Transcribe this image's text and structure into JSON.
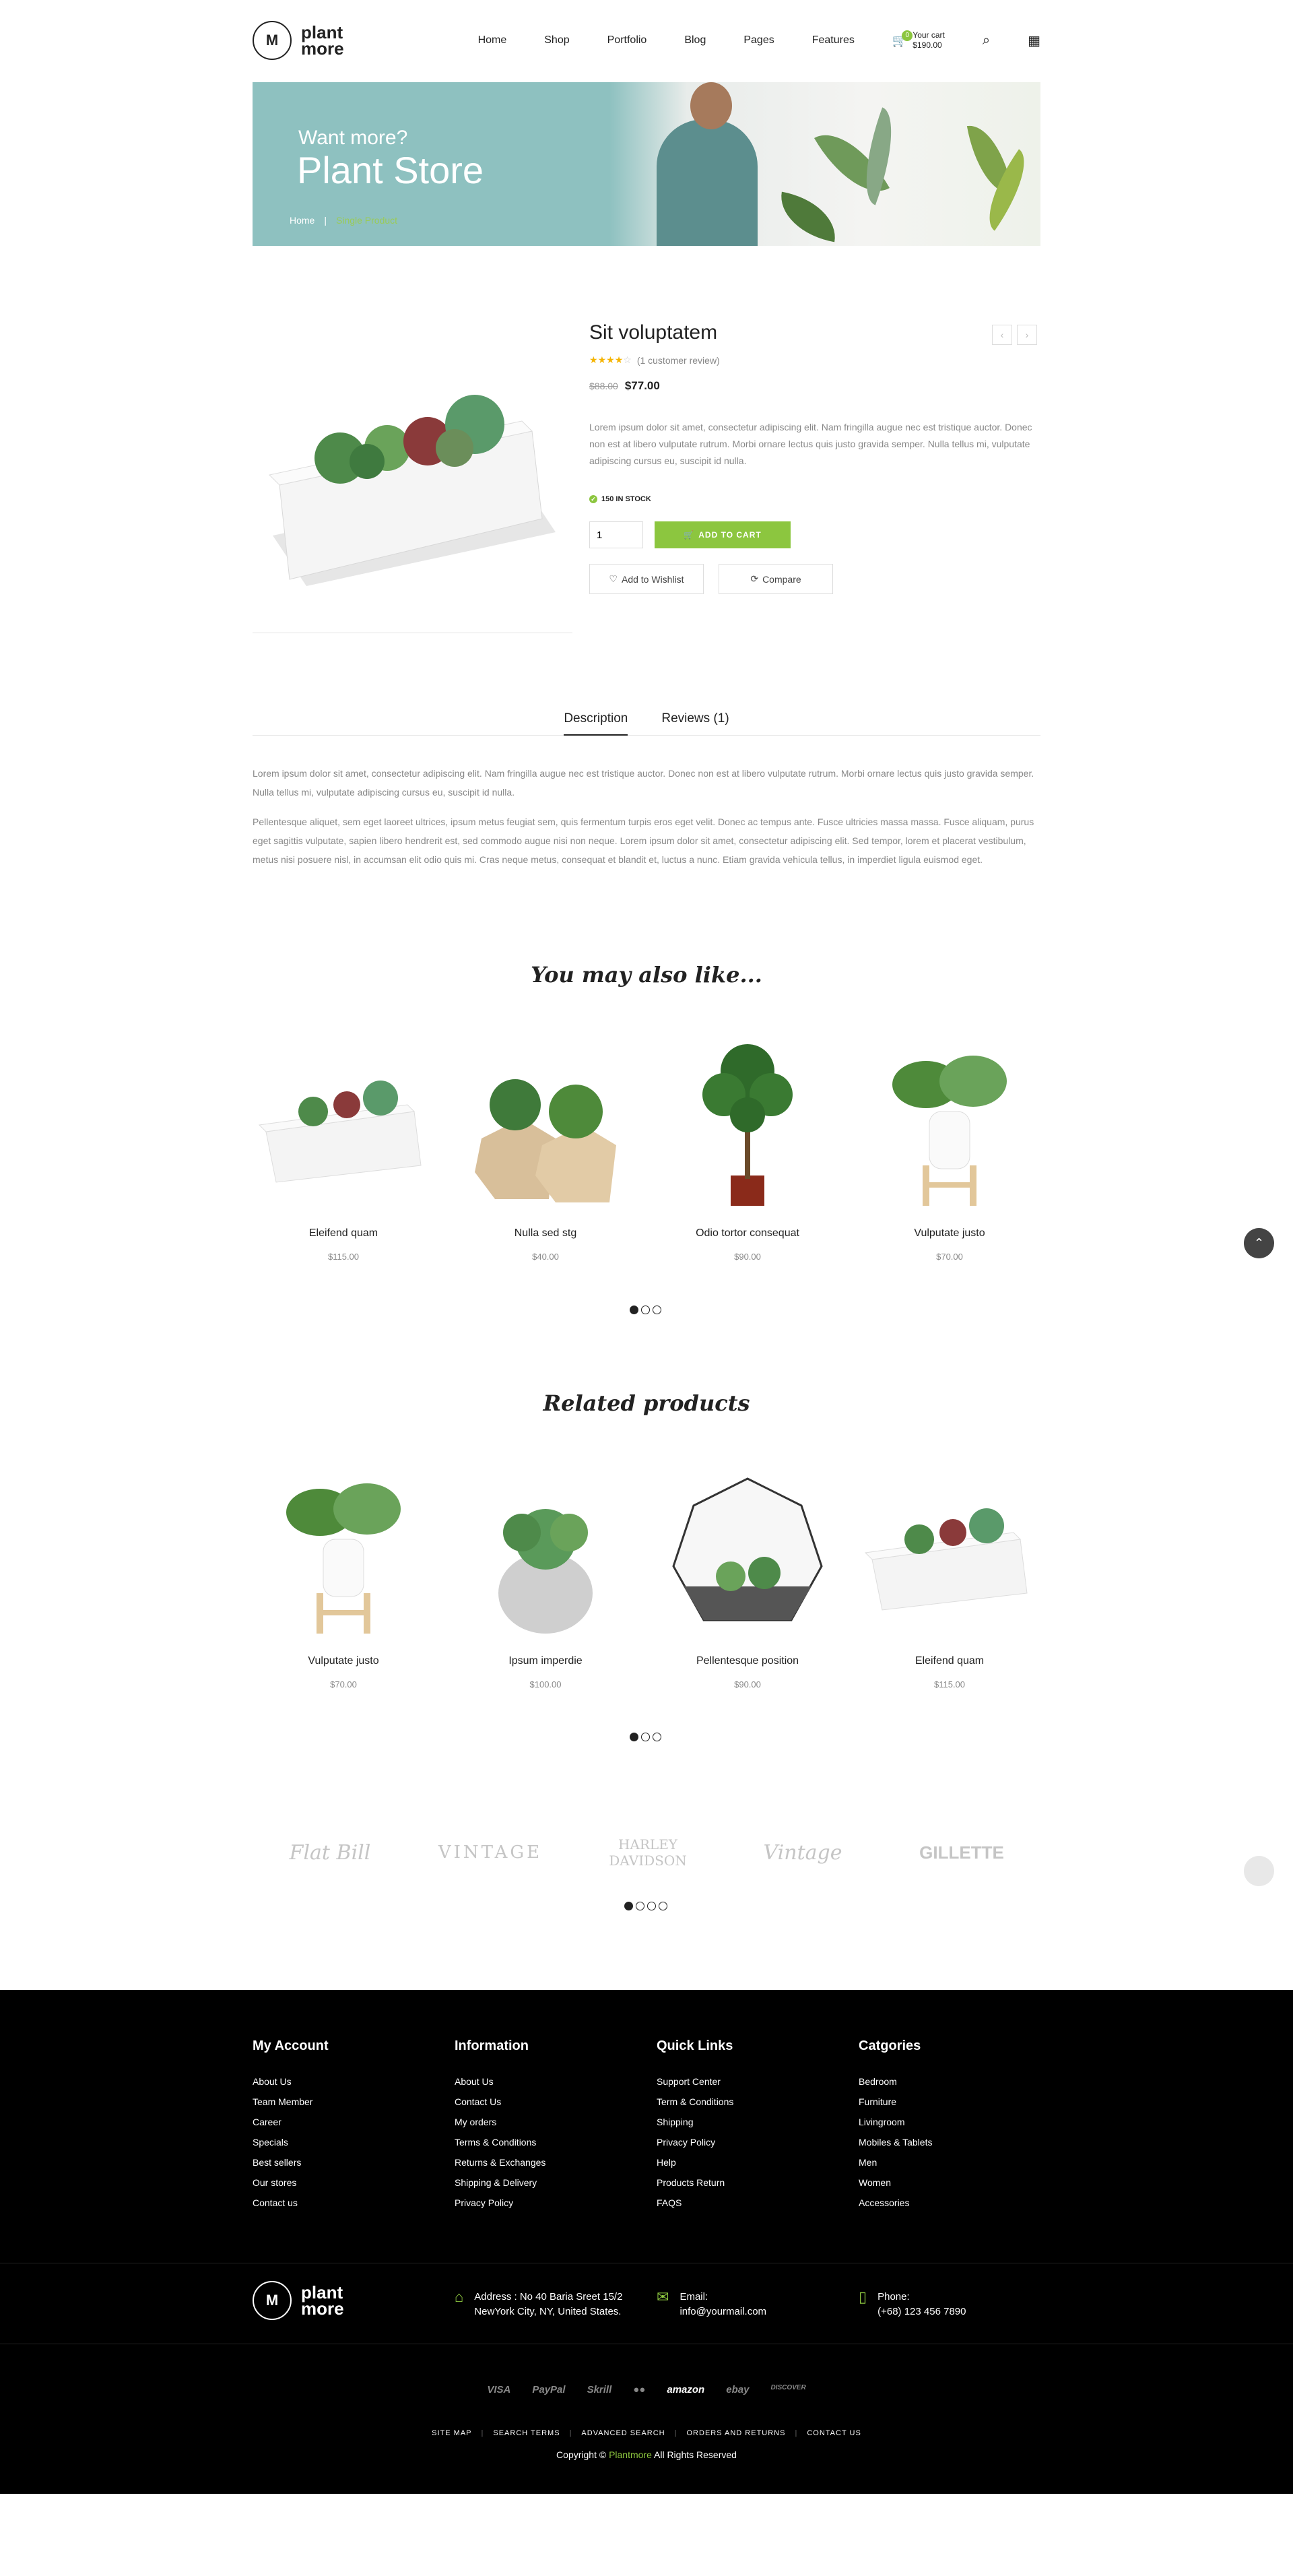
{
  "header": {
    "logo_mark": "M",
    "logo_line1": "plant",
    "logo_line2": "more",
    "nav": [
      "Home",
      "Shop",
      "Portfolio",
      "Blog",
      "Pages",
      "Features"
    ],
    "cart_count": "0",
    "cart_label": "Your cart",
    "cart_total": "$190.00"
  },
  "banner": {
    "subtitle": "Want more?",
    "title": "Plant Store",
    "crumb_home": "Home",
    "crumb_sep": "|",
    "crumb_current": "Single Product"
  },
  "product": {
    "title": "Sit voluptatem",
    "rating_stars": 4,
    "review_text": "(1 customer review)",
    "old_price": "$88.00",
    "new_price": "$77.00",
    "description": "Lorem ipsum dolor sit amet, consectetur adipiscing elit. Nam fringilla augue nec est tristique auctor. Donec non est at libero vulputate rutrum. Morbi ornare lectus quis justo gravida semper. Nulla tellus mi, vulputate adipiscing cursus eu, suscipit id nulla.",
    "stock": "150 IN STOCK",
    "qty": "1",
    "add_to_cart": "ADD TO CART",
    "wishlist": "Add to Wishlist",
    "compare": "Compare",
    "prev": "‹",
    "next": "›"
  },
  "tabs": {
    "description": "Description",
    "reviews": "Reviews (1)",
    "p1": "Lorem ipsum dolor sit amet, consectetur adipiscing elit. Nam fringilla augue nec est tristique auctor. Donec non est at libero vulputate rutrum. Morbi ornare lectus quis justo gravida semper. Nulla tellus mi, vulputate adipiscing cursus eu, suscipit id nulla.",
    "p2": "Pellentesque aliquet, sem eget laoreet ultrices, ipsum metus feugiat sem, quis fermentum turpis eros eget velit. Donec ac tempus ante. Fusce ultricies massa massa. Fusce aliquam, purus eget sagittis vulputate, sapien libero hendrerit est, sed commodo augue nisi non neque. Lorem ipsum dolor sit amet, consectetur adipiscing elit. Sed tempor, lorem et placerat vestibulum, metus nisi posuere nisl, in accumsan elit odio quis mi. Cras neque metus, consequat et blandit et, luctus a nunc. Etiam gravida vehicula tellus, in imperdiet ligula euismod eget."
  },
  "also_like": {
    "title": "You may also like...",
    "items": [
      {
        "name": "Eleifend quam",
        "price": "$115.00"
      },
      {
        "name": "Nulla sed stg",
        "price": "$40.00"
      },
      {
        "name": "Odio tortor consequat",
        "price": "$90.00"
      },
      {
        "name": "Vulputate justo",
        "price": "$70.00"
      }
    ]
  },
  "related": {
    "title": "Related products",
    "items": [
      {
        "name": "Vulputate justo",
        "price": "$70.00"
      },
      {
        "name": "Ipsum imperdie",
        "price": "$100.00"
      },
      {
        "name": "Pellentesque position",
        "price": "$90.00"
      },
      {
        "name": "Eleifend quam",
        "price": "$115.00"
      }
    ]
  },
  "brands": [
    "Flat Bill",
    "VINTAGE",
    "HARLEY DAVIDSON",
    "Vintage",
    "GILLETTE"
  ],
  "footer": {
    "cols": [
      {
        "title": "My Account",
        "items": [
          "About Us",
          "Team Member",
          "Career",
          "Specials",
          "Best sellers",
          "Our stores",
          "Contact us"
        ]
      },
      {
        "title": "Information",
        "items": [
          "About Us",
          "Contact Us",
          "My orders",
          "Terms & Conditions",
          "Returns & Exchanges",
          "Shipping & Delivery",
          "Privacy Policy"
        ]
      },
      {
        "title": "Quick Links",
        "items": [
          "Support Center",
          "Term & Conditions",
          "Shipping",
          "Privacy Policy",
          "Help",
          "Products Return",
          "FAQS"
        ]
      },
      {
        "title": "Catgories",
        "items": [
          "Bedroom",
          "Furniture",
          "Livingroom",
          "Mobiles & Tablets",
          "Men",
          "Women",
          "Accessories"
        ]
      }
    ],
    "address_line1": "Address : No 40 Baria Sreet 15/2",
    "address_line2": "NewYork City, NY, United States.",
    "email_label": "Email:",
    "email": "info@yourmail.com",
    "phone_label": "Phone:",
    "phone": "(+68) 123 456 7890",
    "payments": [
      "VISA",
      "PayPal",
      "Skrill",
      "●●",
      "amazon",
      "ebay",
      "DISCOVER"
    ],
    "links": [
      "SITE MAP",
      "SEARCH TERMS",
      "ADVANCED SEARCH",
      "ORDERS AND RETURNS",
      "CONTACT US"
    ],
    "copy_pre": "Copyright ©",
    "copy_brand": "Plantmore",
    "copy_post": "All Rights Reserved"
  },
  "colors": {
    "accent": "#8cc63f",
    "banner": "#8ec1c0",
    "footer": "#000000"
  }
}
